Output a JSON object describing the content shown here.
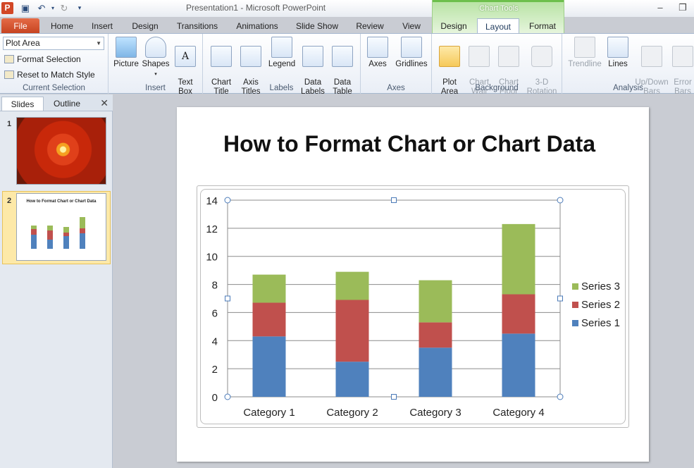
{
  "app": {
    "icon_letter": "P",
    "doc_title": "Presentation1  -  Microsoft PowerPoint",
    "context_tab_group": "Chart Tools"
  },
  "tabs": [
    "File",
    "Home",
    "Insert",
    "Design",
    "Transitions",
    "Animations",
    "Slide Show",
    "Review",
    "View",
    "Design",
    "Layout",
    "Format"
  ],
  "active_tab": "Layout",
  "ribbon": {
    "current_selection": {
      "dropdown_value": "Plot Area",
      "format_selection": "Format Selection",
      "reset_style": "Reset to Match Style",
      "label": "Current Selection"
    },
    "insert": {
      "label": "Insert",
      "buttons": [
        "Picture",
        "Shapes",
        "Text\nBox"
      ]
    },
    "labels": {
      "label": "Labels",
      "buttons": [
        "Chart\nTitle",
        "Axis\nTitles",
        "Legend",
        "Data\nLabels",
        "Data\nTable"
      ]
    },
    "axes": {
      "label": "Axes",
      "buttons": [
        "Axes",
        "Gridlines"
      ]
    },
    "background": {
      "label": "Background",
      "buttons": [
        "Plot\nArea",
        "Chart\nWall",
        "Chart\nFloor",
        "3-D\nRotation"
      ]
    },
    "analysis": {
      "label": "Analysis",
      "buttons": [
        "Trendline",
        "Lines",
        "Up/Down\nBars",
        "Error\nBars"
      ]
    }
  },
  "pane": {
    "tabs": [
      "Slides",
      "Outline"
    ],
    "active": "Slides",
    "close_glyph": "✕",
    "slides": [
      {
        "number": "1"
      },
      {
        "number": "2",
        "title": "How to Format Chart or Chart Data"
      }
    ]
  },
  "slide": {
    "title": "How to Format Chart or Chart Data"
  },
  "colors": {
    "series1": "#4f81bd",
    "series2": "#c0504d",
    "series3": "#9bbb59",
    "file_tab": "#d24726",
    "chart_tools": "#6dbf4c"
  },
  "chart_data": {
    "type": "bar",
    "stacked": true,
    "categories": [
      "Category 1",
      "Category 2",
      "Category 3",
      "Category 4"
    ],
    "series": [
      {
        "name": "Series 1",
        "values": [
          4.3,
          2.5,
          3.5,
          4.5
        ]
      },
      {
        "name": "Series 2",
        "values": [
          2.4,
          4.4,
          1.8,
          2.8
        ]
      },
      {
        "name": "Series 3",
        "values": [
          2.0,
          2.0,
          3.0,
          5.0
        ]
      }
    ],
    "ylim": [
      0,
      14
    ],
    "yticks": [
      "0",
      "2",
      "4",
      "6",
      "8",
      "10",
      "12",
      "14"
    ],
    "grid": true,
    "legend": "right"
  }
}
